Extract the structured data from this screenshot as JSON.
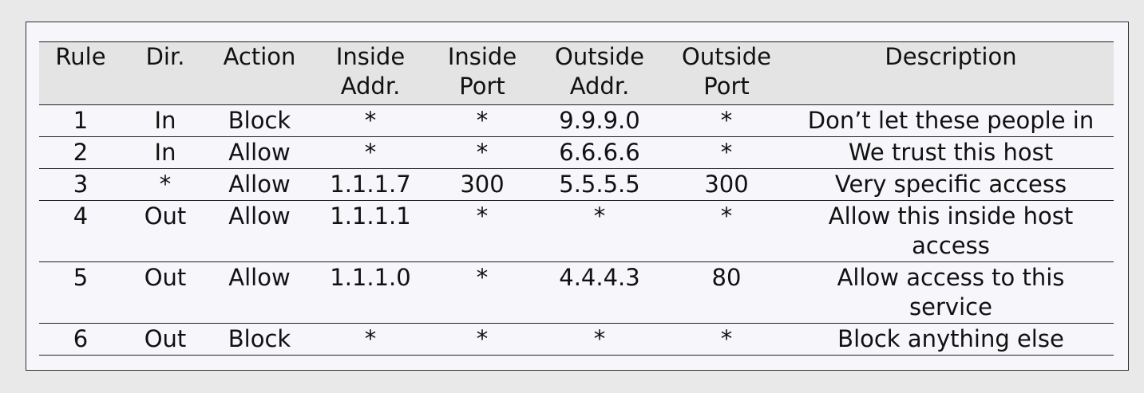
{
  "table": {
    "headers": [
      [
        "Rule"
      ],
      [
        "Dir."
      ],
      [
        "Action"
      ],
      [
        "Inside",
        "Addr."
      ],
      [
        "Inside",
        "Port"
      ],
      [
        "Outside",
        "Addr."
      ],
      [
        "Outside",
        "Port"
      ],
      [
        "Description"
      ]
    ],
    "rows": [
      [
        "1",
        "In",
        "Block",
        "*",
        "*",
        "9.9.9.0",
        "*",
        "Don’t let these people in"
      ],
      [
        "2",
        "In",
        "Allow",
        "*",
        "*",
        "6.6.6.6",
        "*",
        "We trust this host"
      ],
      [
        "3",
        "*",
        "Allow",
        "1.1.1.7",
        "300",
        "5.5.5.5",
        "300",
        "Very specific access"
      ],
      [
        "4",
        "Out",
        "Allow",
        "1.1.1.1",
        "*",
        "*",
        "*",
        "Allow this inside host access"
      ],
      [
        "5",
        "Out",
        "Allow",
        "1.1.1.0",
        "*",
        "4.4.4.3",
        "80",
        "Allow access to this service"
      ],
      [
        "6",
        "Out",
        "Block",
        "*",
        "*",
        "*",
        "*",
        "Block anything else"
      ]
    ]
  }
}
